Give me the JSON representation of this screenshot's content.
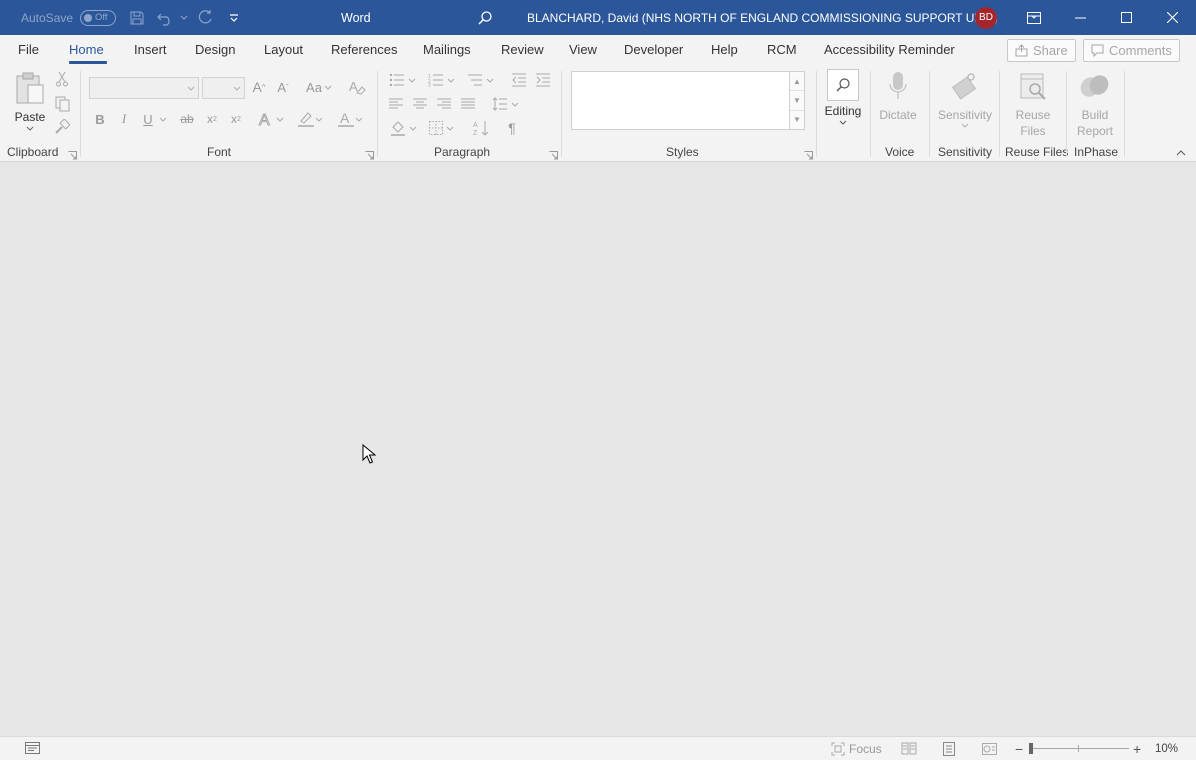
{
  "titlebar": {
    "autosave_label": "AutoSave",
    "autosave_state": "Off",
    "app_name": "Word",
    "user_name": "BLANCHARD, David (NHS NORTH OF ENGLAND COMMISSIONING SUPPORT UNIT)",
    "user_initials": "BD",
    "avatar_color": "#a4262c",
    "accent_color": "#2b579a"
  },
  "tabs": [
    {
      "label": "File"
    },
    {
      "label": "Home"
    },
    {
      "label": "Insert"
    },
    {
      "label": "Design"
    },
    {
      "label": "Layout"
    },
    {
      "label": "References"
    },
    {
      "label": "Mailings"
    },
    {
      "label": "Review"
    },
    {
      "label": "View"
    },
    {
      "label": "Developer"
    },
    {
      "label": "Help"
    },
    {
      "label": "RCM"
    },
    {
      "label": "Accessibility Reminder"
    }
  ],
  "active_tab": "Home",
  "share_label": "Share",
  "comments_label": "Comments",
  "ribbon": {
    "clipboard": {
      "label": "Clipboard",
      "paste_label": "Paste"
    },
    "font": {
      "label": "Font",
      "font_case_label": "Aa"
    },
    "paragraph": {
      "label": "Paragraph"
    },
    "styles": {
      "label": "Styles"
    },
    "editing": {
      "label": "Editing"
    },
    "voice": {
      "label": "Voice",
      "dictate_label": "Dictate"
    },
    "sensitivity": {
      "label": "Sensitivity",
      "button_label": "Sensitivity"
    },
    "reuse_files": {
      "label": "Reuse Files",
      "button_line1": "Reuse",
      "button_line2": "Files"
    },
    "inphase": {
      "label": "InPhase",
      "button_line1": "Build",
      "button_line2": "Report"
    }
  },
  "statusbar": {
    "focus_label": "Focus",
    "zoom_level": "10%"
  }
}
